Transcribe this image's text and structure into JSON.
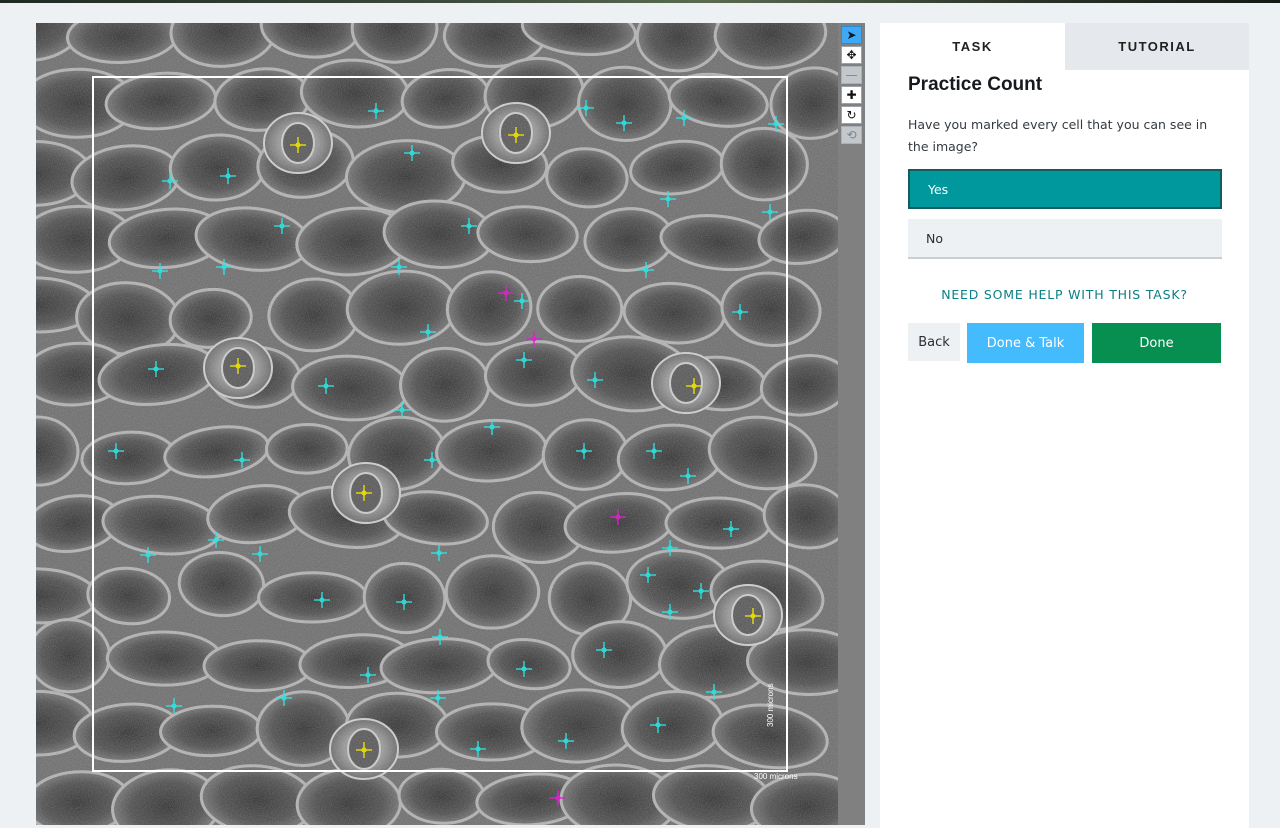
{
  "viewer": {
    "scale_label": "300 microns",
    "tools": [
      {
        "name": "pointer-tool",
        "icon": "arrow-pointer-icon",
        "glyph": "➤",
        "state": "active"
      },
      {
        "name": "pan-tool",
        "icon": "move-icon",
        "glyph": "✥",
        "state": "normal"
      },
      {
        "name": "zoom-out-tool",
        "icon": "minus-icon",
        "glyph": "—",
        "state": "disabled"
      },
      {
        "name": "zoom-in-tool",
        "icon": "plus-icon",
        "glyph": "✚",
        "state": "normal"
      },
      {
        "name": "rotate-tool",
        "icon": "rotate-icon",
        "glyph": "↻",
        "state": "normal"
      },
      {
        "name": "reset-tool",
        "icon": "refresh-icon",
        "glyph": "⟲",
        "state": "disabled"
      }
    ],
    "marker_colors": {
      "cell": "#2ee6e6",
      "stoma": "#f2e600",
      "other": "#e020d0"
    }
  },
  "panel": {
    "tabs": [
      {
        "label": "TASK",
        "active": true
      },
      {
        "label": "TUTORIAL",
        "active": false
      }
    ],
    "title": "Practice Count",
    "question": "Have you marked every cell that you can see in the image?",
    "answers": [
      {
        "label": "Yes",
        "selected": true
      },
      {
        "label": "No",
        "selected": false
      }
    ],
    "help_link": "NEED SOME HELP WITH THIS TASK?",
    "buttons": {
      "back": "Back",
      "done_talk": "Done & Talk",
      "done": "Done"
    }
  },
  "colors": {
    "accent_teal": "#00979d",
    "done_green": "#078f52",
    "talk_blue": "#43bbfd",
    "help_link": "#0a7f86",
    "active_tool": "#3fa9f5"
  }
}
